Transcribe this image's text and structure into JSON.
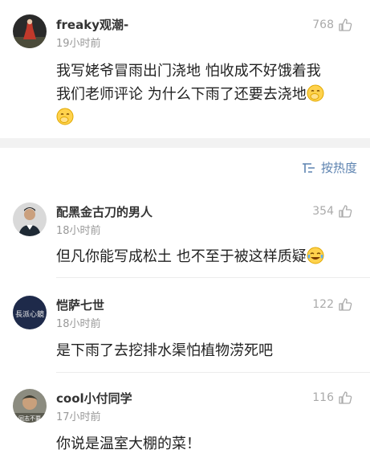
{
  "sort": {
    "label": "按热度",
    "icon": "sort-icon"
  },
  "comments": [
    {
      "username": "freaky观潮-",
      "time": "19小时前",
      "likes": "768",
      "text_line1": "我写姥爷冒雨出门浇地 怕收成不好饿着我",
      "text_line2": "我们老师评论 为什么下雨了还要去浇地"
    },
    {
      "username": "配黑金古刀的男人",
      "time": "18小时前",
      "likes": "354",
      "text": "但凡你能写成松土 也不至于被这样质疑"
    },
    {
      "username": "恺萨七世",
      "time": "18小时前",
      "likes": "122",
      "text": "是下雨了去挖排水渠怕植物涝死吧",
      "avatar_text": "長派心鏡"
    },
    {
      "username": "cool小付同学",
      "time": "17小时前",
      "likes": "116",
      "text": "你说是温室大棚的菜！",
      "avatar_text": "同志不要"
    }
  ],
  "colors": {
    "link_blue": "#5d83b0",
    "muted": "#999999",
    "separator": "#f2f2f2"
  }
}
